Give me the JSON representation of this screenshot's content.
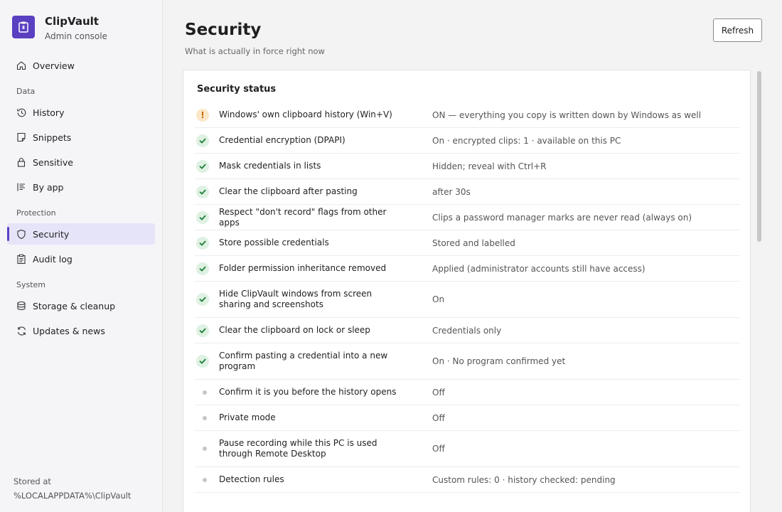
{
  "brand": {
    "name": "ClipVault",
    "subtitle": "Admin console"
  },
  "colors": {
    "accent": "#5b3fc1",
    "ok": "#1a7f37",
    "warning": "#c26a00"
  },
  "nav": {
    "overview": "Overview",
    "section_data": "Data",
    "history": "History",
    "snippets": "Snippets",
    "sensitive": "Sensitive",
    "by_app": "By app",
    "section_protection": "Protection",
    "security": "Security",
    "audit_log": "Audit log",
    "section_system": "System",
    "storage": "Storage & cleanup",
    "updates": "Updates & news"
  },
  "footer": {
    "label": "Stored at",
    "path": "%LOCALAPPDATA%\\ClipVault"
  },
  "page": {
    "title": "Security",
    "subtitle": "What is actually in force right now",
    "refresh_label": "Refresh"
  },
  "card": {
    "title": "Security status",
    "rows": [
      {
        "status": "warning",
        "icon": "warning-icon",
        "label": "Windows' own clipboard history (Win+V)",
        "value": "ON — everything you copy is written down by Windows as well"
      },
      {
        "status": "ok",
        "icon": "check-icon",
        "label": "Credential encryption (DPAPI)",
        "value": "On · encrypted clips: 1 · available on this PC"
      },
      {
        "status": "ok",
        "icon": "check-icon",
        "label": "Mask credentials in lists",
        "value": "Hidden; reveal with Ctrl+R"
      },
      {
        "status": "ok",
        "icon": "check-icon",
        "label": "Clear the clipboard after pasting",
        "value": "after 30s"
      },
      {
        "status": "ok",
        "icon": "check-icon",
        "label": "Respect \"don't record\" flags from other apps",
        "value": "Clips a password manager marks are never read (always on)"
      },
      {
        "status": "ok",
        "icon": "check-icon",
        "label": "Store possible credentials",
        "value": "Stored and labelled"
      },
      {
        "status": "ok",
        "icon": "check-icon",
        "label": "Folder permission inheritance removed",
        "value": "Applied (administrator accounts still have access)"
      },
      {
        "status": "ok",
        "icon": "check-icon",
        "label": "Hide ClipVault windows from screen sharing and screenshots",
        "value": "On"
      },
      {
        "status": "ok",
        "icon": "check-icon",
        "label": "Clear the clipboard on lock or sleep",
        "value": "Credentials only"
      },
      {
        "status": "ok",
        "icon": "check-icon",
        "label": "Confirm pasting a credential into a new program",
        "value": "On · No program confirmed yet"
      },
      {
        "status": "off",
        "icon": "dot-icon",
        "label": "Confirm it is you before the history opens",
        "value": "Off"
      },
      {
        "status": "off",
        "icon": "dot-icon",
        "label": "Private mode",
        "value": "Off"
      },
      {
        "status": "off",
        "icon": "dot-icon",
        "label": "Pause recording while this PC is used through Remote Desktop",
        "value": "Off"
      },
      {
        "status": "off",
        "icon": "dot-icon",
        "label": "Detection rules",
        "value": "Custom rules: 0 · history checked: pending"
      }
    ]
  }
}
